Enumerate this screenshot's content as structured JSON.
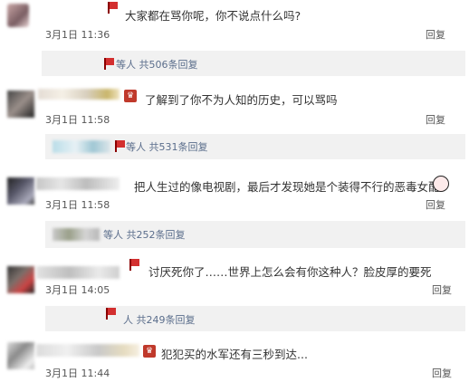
{
  "colors": {
    "link_blue": "#5b6e8c",
    "reply_bar_bg": "#f1f1f1",
    "flag_red": "#d32f2f",
    "text_dark": "#333333"
  },
  "comments": [
    {
      "text": "大家都在骂你呢，你不说点什么吗?",
      "time": "3月1日 11:36",
      "reply_label": "回复",
      "reply_summary": "等人 共506条回复"
    },
    {
      "text": "了解到了你不为人知的历史，可以骂吗",
      "time": "3月1日 11:58",
      "reply_label": "回复",
      "reply_summary": "等人 共531条回复"
    },
    {
      "text": "把人生过的像电视剧，最后才发现她是个装得不行的恶毒女配",
      "time": "3月1日 11:58",
      "reply_label": "回复",
      "reply_summary": "等人 共252条回复"
    },
    {
      "text": "讨厌死你了……世界上怎么会有你这种人？脸皮厚的要死",
      "time": "3月1日 14:05",
      "reply_label": "回复",
      "reply_summary": "人 共249条回复"
    },
    {
      "text": "犯犯买的水军还有三秒到达...",
      "time": "3月1日 11:44",
      "reply_label": "回复"
    }
  ]
}
